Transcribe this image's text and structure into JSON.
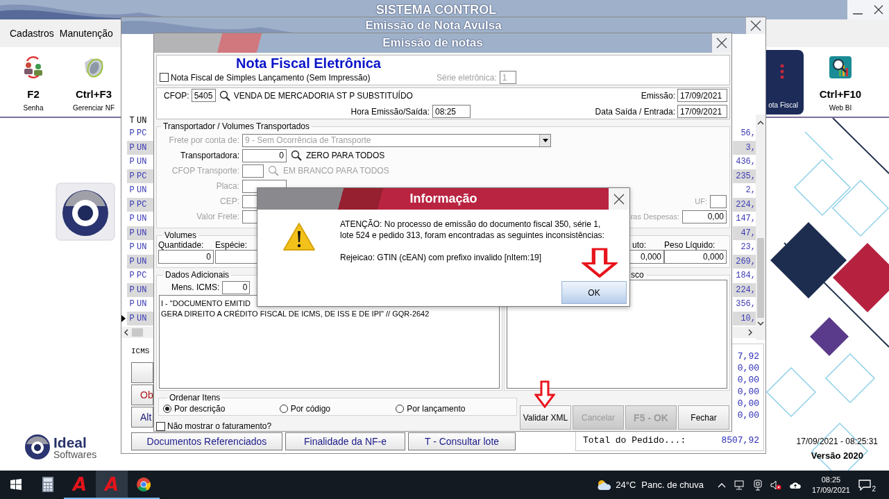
{
  "main": {
    "title": "SISTEMA CONTROL",
    "menu": [
      "Cadastros",
      "Manutenção"
    ],
    "toolbar": [
      {
        "key": "F2",
        "label": "Senha",
        "kind": "users",
        "selected": false
      },
      {
        "key": "Ctrl+F3",
        "label": "Gerenciar NF",
        "kind": "nfe",
        "selected": false
      },
      {
        "label": "ota Fiscal",
        "kind": "dots",
        "selected": true
      },
      {
        "key": "Ctrl+F10",
        "label": "Web BI",
        "kind": "bi",
        "selected": false
      }
    ],
    "logo": {
      "name": "Ideal",
      "subtitle": "Softwares"
    },
    "timestamp": "17/09/2021 - 08:25:31",
    "version": "Versão 2020"
  },
  "avulsa": {
    "title": "Emissão de Nota Avulsa",
    "columns": [
      "T",
      "UN"
    ],
    "rows": [
      {
        "t": "P",
        "un": "PC",
        "value": "56,",
        "current": false
      },
      {
        "t": "P",
        "un": "UN",
        "value": "3,",
        "current": false
      },
      {
        "t": "P",
        "un": "UN",
        "value": "436,",
        "current": false
      },
      {
        "t": "P",
        "un": "PC",
        "value": "235,",
        "current": false
      },
      {
        "t": "P",
        "un": "UN",
        "value": "2,",
        "current": false
      },
      {
        "t": "P",
        "un": "PC",
        "value": "224,",
        "current": false
      },
      {
        "t": "P",
        "un": "UN",
        "value": "147,",
        "current": false
      },
      {
        "t": "P",
        "un": "UN",
        "value": "47,",
        "current": false
      },
      {
        "t": "P",
        "un": "UN",
        "value": "23,",
        "current": false
      },
      {
        "t": "P",
        "un": "UN",
        "value": "269,",
        "current": false
      },
      {
        "t": "P",
        "un": "PC",
        "value": "184,",
        "current": false
      },
      {
        "t": "P",
        "un": "UN",
        "value": "224,",
        "current": false
      },
      {
        "t": "P",
        "un": "UN",
        "value": "356,",
        "current": false
      },
      {
        "t": "P",
        "un": "UN",
        "value": "10,",
        "current": true
      }
    ],
    "icms_label": "ICMS",
    "side_buttons": [
      {
        "kind": "blank"
      },
      {
        "kind": "warning",
        "label": "Ob"
      },
      {
        "kind": "plain",
        "label": "Alt"
      }
    ],
    "bottom_buttons": [
      "Documentos Referenciados",
      "Finalidade da NF-e",
      "T - Consultar lote"
    ],
    "totals": [
      "7,92",
      "0,00",
      "0,00",
      "0,00",
      "0,00",
      "0,00"
    ],
    "total_label": "Total do Pedido...:",
    "total_value": "8507,92"
  },
  "notas": {
    "title": "Emissão de notas",
    "heading": "Nota Fiscal Eletrônica",
    "simples": {
      "label": "Nota Fiscal de Simples Lançamento (Sem Impressão)",
      "checked": false
    },
    "serie": {
      "label": "Série eletrônica:",
      "value": "1",
      "disabled": true
    },
    "cfop": {
      "label": "CFOP:",
      "value": "5405",
      "description": "VENDA DE MERCADORIA ST P SUBSTITUÍDO"
    },
    "emissao": {
      "label": "Emissão:",
      "value": "17/09/2021"
    },
    "hora": {
      "label": "Hora Emissão/Saída:",
      "value": "08:25"
    },
    "saida": {
      "label": "Data Saída / Entrada:",
      "value": "17/09/2021"
    },
    "transport": {
      "legend": "Transportador /  Volumes Transportados",
      "rows": [
        {
          "kind": "select",
          "label": "Frete por conta de:",
          "disabled": true,
          "value": "9 - Sem Ocorrência de Transporte"
        },
        {
          "kind": "lookup",
          "label": "Transportadora:",
          "disabled": false,
          "narrow": false,
          "value": "0",
          "hint": "ZERO PARA TODOS"
        },
        {
          "kind": "lookup",
          "label": "CFOP Transporte:",
          "disabled": true,
          "narrow": true,
          "hint": "EM BRANCO PARA TODOS"
        },
        {
          "kind": "field",
          "label": "Placa:",
          "disabled": true
        },
        {
          "kind": "field",
          "label": "CEP:",
          "disabled": true,
          "side_label": "UF:"
        },
        {
          "kind": "field",
          "label": "Valor Frete:",
          "disabled": true,
          "side_label": "ras Despesas:",
          "side_value": "0,00"
        }
      ]
    },
    "volumes": {
      "legend": "Volumes",
      "fields": [
        {
          "label": "Quantidade:",
          "value": "0"
        },
        {
          "label": "Espécie:"
        }
      ],
      "weights": [
        {
          "label": "uto:",
          "value": "0,000"
        },
        {
          "label": "Peso Líquido:",
          "value": "0,000"
        }
      ]
    },
    "dados": {
      "legend": "Dados Adicionais",
      "mens_label": "Mens. ICMS:",
      "mens_value": "0",
      "text_lines": [
        "I - \"DOCUMENTO EMITID",
        "GERA DIREITO A CRÉDITO FISCAL DE ICMS, DE ISS E DE IPI\" // GQR-2642"
      ],
      "fisco_legend": "sco"
    },
    "ordenar": {
      "legend": "Ordenar Itens",
      "options": [
        {
          "label": "Por descrição",
          "selected": true
        },
        {
          "label": "Por código",
          "selected": false
        },
        {
          "label": "Por lançamento",
          "selected": false
        }
      ]
    },
    "hide_billing": {
      "label": "Não mostrar o faturamento?",
      "checked": false
    },
    "buttons": [
      {
        "label": "Validar XML",
        "disabled": false,
        "emphasis": false
      },
      {
        "label": "Cancelar",
        "disabled": true,
        "emphasis": false
      },
      {
        "label": "F5 - OK",
        "disabled": true,
        "emphasis": true
      },
      {
        "label": "Fechar",
        "disabled": false,
        "emphasis": false
      }
    ]
  },
  "dialog": {
    "title": "Informação",
    "lines": [
      "ATENÇÃO: No processo de emissão do documento fiscal 350, série 1,",
      "lote 524 e pedido 313, foram encontradas as seguintes inconsistências:"
    ],
    "detail": "Rejeicao: GTIN (cEAN) com prefixo invalido [nItem:19]",
    "button": "OK"
  },
  "taskbar": {
    "apps": [
      {
        "kind": "start",
        "running": false,
        "selected": false
      },
      {
        "kind": "calculator",
        "running": false,
        "selected": false
      },
      {
        "kind": "letter",
        "label": "A",
        "running": true,
        "selected": false
      },
      {
        "kind": "letter",
        "label": "A",
        "running": true,
        "selected": true
      },
      {
        "kind": "chrome",
        "running": true,
        "selected": false
      }
    ],
    "temperature": "24°C",
    "weather": "Panc. de chuva",
    "time": "08:25",
    "date": "17/09/2021",
    "notifications": "2"
  }
}
